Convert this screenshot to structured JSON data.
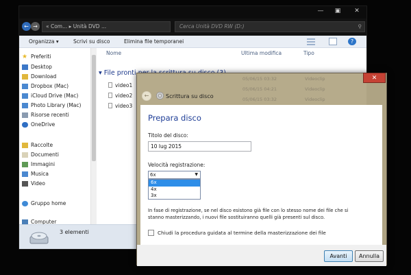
{
  "explorer": {
    "address": "« Com...  ▸  Unità DVD ...",
    "search_placeholder": "Cerca Unità DVD RW (D:)",
    "toolbar": {
      "organize": "Organizza ▾",
      "burn": "Scrivi su disco",
      "delete_temp": "Elimina file temporanei"
    },
    "nav": {
      "favorites": "Preferiti",
      "desktop": "Desktop",
      "download": "Download",
      "dropbox": "Dropbox (Mac)",
      "icloud": "iCloud Drive (Mac)",
      "photo_library": "Photo Library (Mac)",
      "recent": "Risorse recenti",
      "onedrive": "OneDrive",
      "libraries": "Raccolte",
      "documents": "Documenti",
      "images": "Immagini",
      "music": "Musica",
      "video": "Video",
      "homegroup": "Gruppo home",
      "computer": "Computer"
    },
    "columns": {
      "name": "Nome",
      "modified": "Ultima modifica",
      "type": "Tipo"
    },
    "group_header": "File pronti per la scrittura su disco (3)",
    "files": [
      {
        "name": "video1",
        "modified": "05/06/15 03:32",
        "type": "Videoclip"
      },
      {
        "name": "video2",
        "modified": "05/06/15 04:21",
        "type": "Videoclip"
      },
      {
        "name": "video3",
        "modified": "05/06/15 03:32",
        "type": "Videoclip"
      }
    ],
    "items_count": "3 elementi"
  },
  "dialog": {
    "window_title": "Scrittura su disco",
    "heading": "Prepara disco",
    "disc_title_label": "Titolo del disco:",
    "disc_title_value": "10 lug 2015",
    "speed_label": "Velocità registrazione:",
    "speed_selected": "6x",
    "speed_options": [
      "6x",
      "4x",
      "3x"
    ],
    "note": "In fase di registrazione, se nel disco esistono già file con lo stesso nome dei file che si stanno masterizzando, i nuovi file sostituiranno quelli già presenti sul disco.",
    "close_checkbox_label": "Chiudi la procedura guidata al termine della masterizzazione dei file",
    "next_button": "Avanti",
    "cancel_button": "Annulla"
  },
  "colors": {
    "accent": "#1e3d96",
    "selection": "#2e8ee8",
    "close": "#c64234"
  },
  "icons": [
    "back-arrow-icon",
    "forward-arrow-icon",
    "search-icon",
    "minimize-icon",
    "maximize-icon",
    "close-icon",
    "star-icon",
    "folder-icon",
    "disc-burn-icon",
    "dvd-drive-icon",
    "help-icon"
  ]
}
